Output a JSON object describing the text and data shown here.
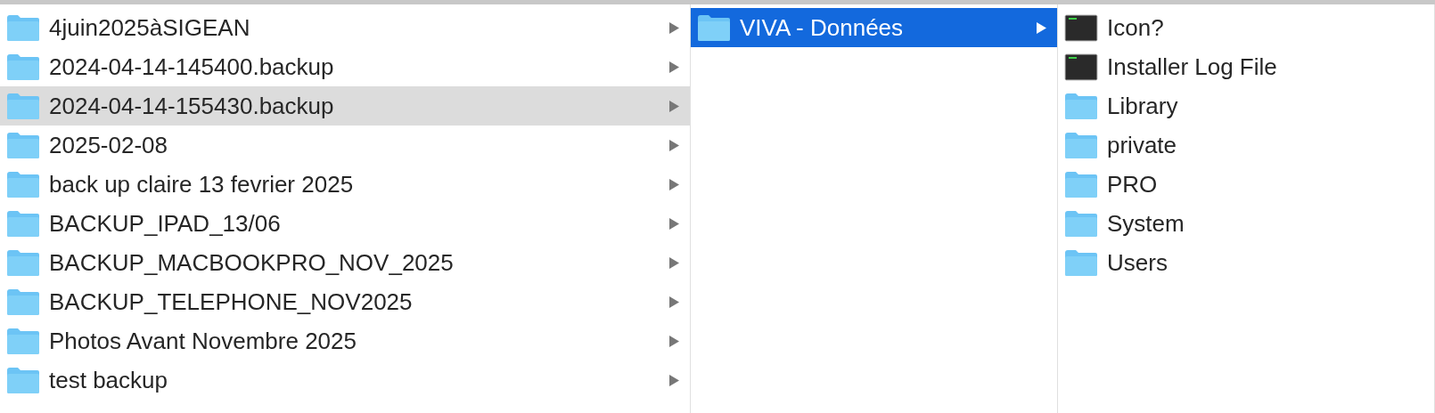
{
  "columns": [
    {
      "focused": false,
      "items": [
        {
          "name": "4juin2025àSIGEAN",
          "kind": "folder",
          "selected": false,
          "expandable": true
        },
        {
          "name": "2024-04-14-145400.backup",
          "kind": "folder",
          "selected": false,
          "expandable": true
        },
        {
          "name": "2024-04-14-155430.backup",
          "kind": "folder",
          "selected": true,
          "expandable": true
        },
        {
          "name": "2025-02-08",
          "kind": "folder",
          "selected": false,
          "expandable": true
        },
        {
          "name": "back up claire 13 fevrier 2025",
          "kind": "folder",
          "selected": false,
          "expandable": true
        },
        {
          "name": "BACKUP_IPAD_13/06",
          "kind": "folder",
          "selected": false,
          "expandable": true
        },
        {
          "name": "BACKUP_MACBOOKPRO_NOV_2025",
          "kind": "folder",
          "selected": false,
          "expandable": true
        },
        {
          "name": "BACKUP_TELEPHONE_NOV2025",
          "kind": "folder",
          "selected": false,
          "expandable": true
        },
        {
          "name": "Photos Avant Novembre 2025",
          "kind": "folder",
          "selected": false,
          "expandable": true
        },
        {
          "name": "test backup",
          "kind": "folder",
          "selected": false,
          "expandable": true
        }
      ]
    },
    {
      "focused": true,
      "items": [
        {
          "name": "VIVA - Données",
          "kind": "folder",
          "selected": true,
          "expandable": true
        }
      ]
    },
    {
      "items": [
        {
          "name": "Icon?",
          "kind": "exec",
          "selected": false,
          "expandable": false
        },
        {
          "name": "Installer Log File",
          "kind": "exec",
          "selected": false,
          "expandable": false
        },
        {
          "name": "Library",
          "kind": "folder",
          "selected": false,
          "expandable": false
        },
        {
          "name": "private",
          "kind": "folder",
          "selected": false,
          "expandable": false
        },
        {
          "name": "PRO",
          "kind": "folder",
          "selected": false,
          "expandable": false
        },
        {
          "name": "System",
          "kind": "folder",
          "selected": false,
          "expandable": false
        },
        {
          "name": "Users",
          "kind": "folder",
          "selected": false,
          "expandable": false
        }
      ]
    }
  ]
}
